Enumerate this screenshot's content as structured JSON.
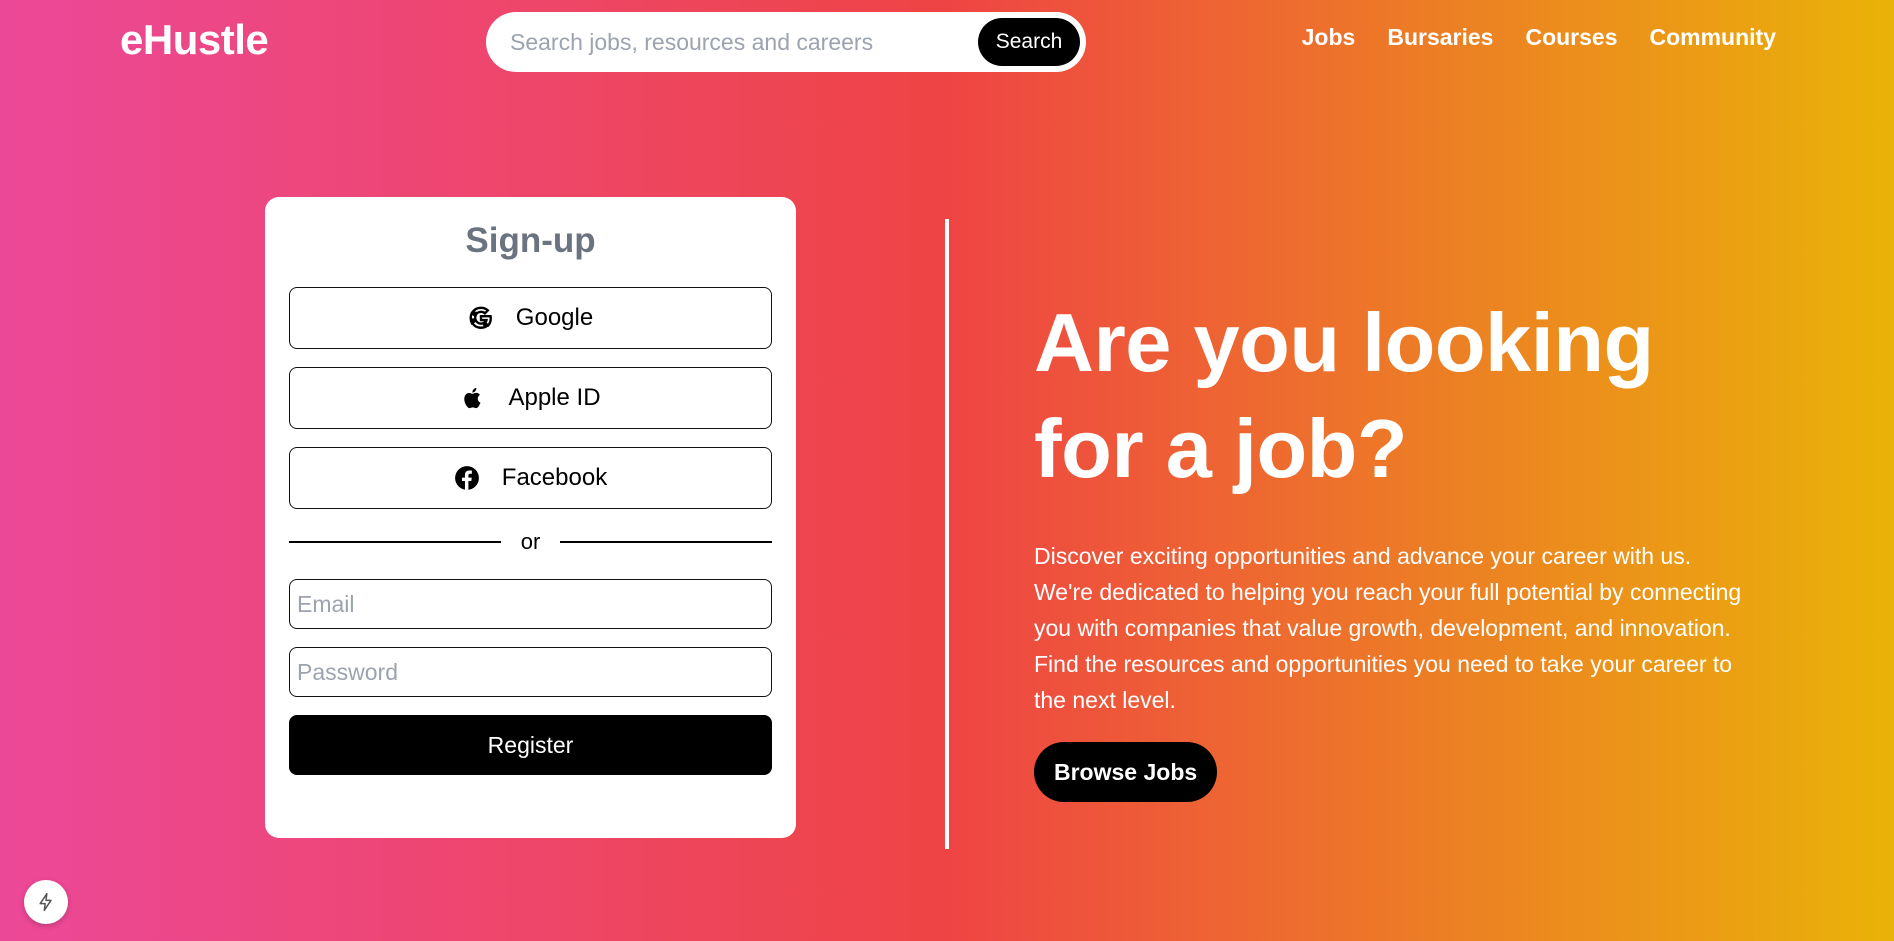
{
  "header": {
    "logo": "eHustle",
    "search": {
      "placeholder": "Search jobs, resources and careers",
      "button": "Search"
    },
    "nav": [
      "Jobs",
      "Bursaries",
      "Courses",
      "Community"
    ]
  },
  "signup": {
    "title": "Sign-up",
    "providers": [
      {
        "label": "Google",
        "icon": "google-icon"
      },
      {
        "label": "Apple ID",
        "icon": "apple-icon"
      },
      {
        "label": "Facebook",
        "icon": "facebook-icon"
      }
    ],
    "divider": "or",
    "email_placeholder": "Email",
    "password_placeholder": "Password",
    "register": "Register"
  },
  "hero": {
    "headline_line1": "Are you looking",
    "headline_line2": "for a job?",
    "description": "Discover exciting opportunities and advance your career with us. We're dedicated to helping you reach your full potential by connecting you with companies that value growth, development, and innovation. Find the resources and opportunities you need to take your career to the next level.",
    "cta": "Browse Jobs"
  },
  "colors": {
    "gradient_start": "#ec4899",
    "gradient_mid": "#ef4444",
    "gradient_end": "#eab308",
    "button": "#000000"
  },
  "floating": {
    "icon": "bolt-icon"
  }
}
